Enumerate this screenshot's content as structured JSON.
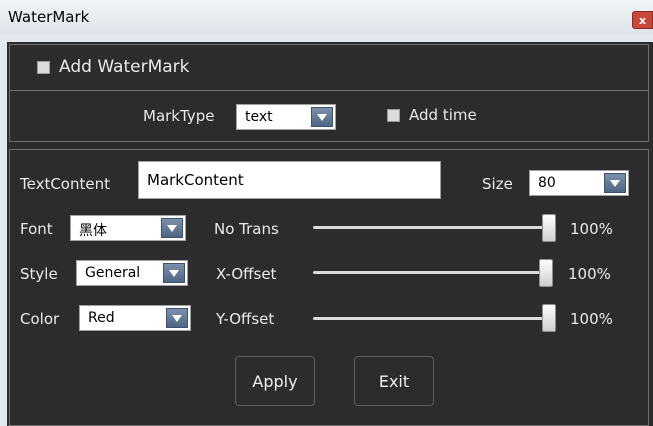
{
  "window": {
    "title": "WaterMark",
    "close_glyph": "x"
  },
  "add_watermark": {
    "label": "Add WaterMark",
    "checked": false
  },
  "mark_type": {
    "label": "MarkType",
    "value": "text"
  },
  "add_time": {
    "label": "Add time",
    "checked": false
  },
  "text_content": {
    "label": "TextContent",
    "value": "MarkContent"
  },
  "size": {
    "label": "Size",
    "value": "80"
  },
  "font": {
    "label": "Font",
    "value": "黑体"
  },
  "style": {
    "label": "Style",
    "value": "General"
  },
  "color": {
    "label": "Color",
    "value": "Red"
  },
  "sliders": [
    {
      "label": "No Trans",
      "value_text": "100%",
      "value": 100
    },
    {
      "label": "X-Offset",
      "value_text": "100%",
      "value": 100
    },
    {
      "label": "Y-Offset",
      "value_text": "100%",
      "value": 100
    }
  ],
  "buttons": {
    "apply": "Apply",
    "exit": "Exit"
  },
  "colors": {
    "panel_bg": "#2c2c2e",
    "title_bg": "#e4e8ee",
    "close_bg": "#c9483a",
    "arrow_blue": "#5a7090"
  }
}
